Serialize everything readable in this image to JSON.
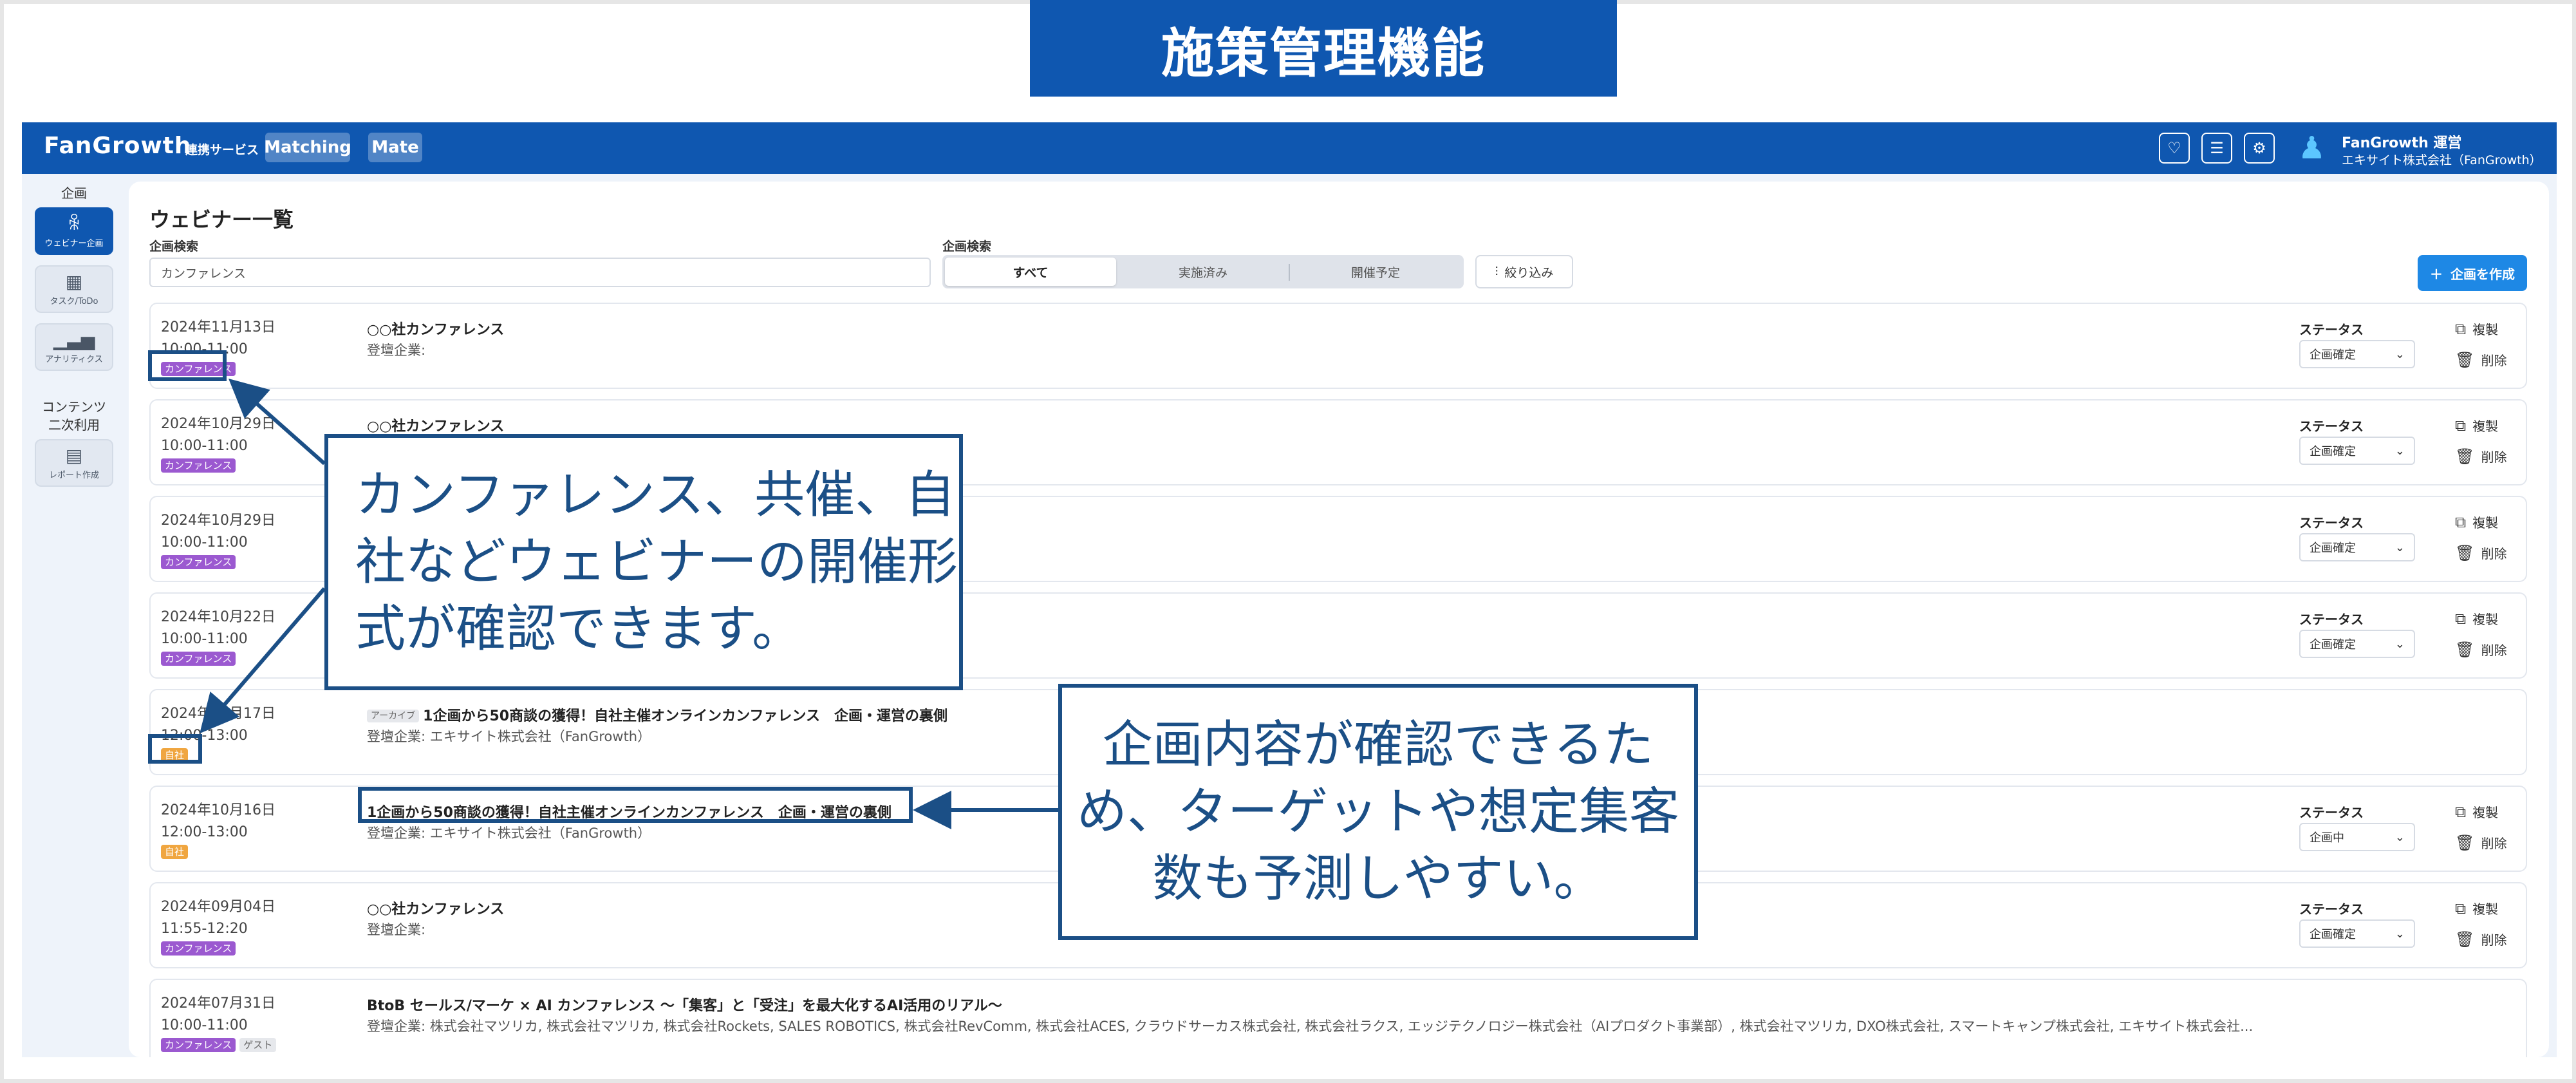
{
  "banner": {
    "title": "施策管理機能"
  },
  "header": {
    "logo": "FanGrowth",
    "services_label": "連携サービス",
    "service_buttons": [
      "Matching",
      "Mate"
    ],
    "user_name": "FanGrowth 運営",
    "user_company": "エキサイト株式会社（FanGrowth）"
  },
  "sidebar": {
    "section1": "企画",
    "items": [
      {
        "label": "ウェビナー企画",
        "icon": "people-icon"
      },
      {
        "label": "タスク/ToDo",
        "icon": "calendar-icon"
      },
      {
        "label": "アナリティクス",
        "icon": "analytics-icon"
      }
    ],
    "section2_line1": "コンテンツ",
    "section2_line2": "二次利用",
    "items2": [
      {
        "label": "レポート作成",
        "icon": "document-icon"
      }
    ]
  },
  "main": {
    "page_title": "ウェビナー一覧",
    "search_label": "企画検索",
    "search_value": "カンファレンス",
    "filter_label": "企画検索",
    "segments": [
      "すべて",
      "実施済み",
      "開催予定"
    ],
    "narrow_button": "絞り込み",
    "create_button": "企画を作成",
    "status_label": "ステータス",
    "copy_label": "複製",
    "delete_label": "削除",
    "company_prefix": "登壇企業:",
    "rows": [
      {
        "date": "2024年11月13日",
        "time": "10:00-11:00",
        "tags": [
          "カンファレンス"
        ],
        "title": "○○社カンファレンス",
        "companies": "",
        "status": "企画確定"
      },
      {
        "date": "2024年10月29日",
        "time": "10:00-11:00",
        "tags": [
          "カンファレンス"
        ],
        "title": "○○社カンファレンス",
        "companies": "",
        "status": "企画確定"
      },
      {
        "date": "2024年10月29日",
        "time": "10:00-11:00",
        "tags": [
          "カンファレンス"
        ],
        "title": "",
        "companies": "",
        "status": "企画確定"
      },
      {
        "date": "2024年10月22日",
        "time": "10:00-11:00",
        "tags": [
          "カンファレンス"
        ],
        "title": "",
        "companies": "",
        "status": "企画確定"
      },
      {
        "date": "2024年10月17日",
        "time": "12:00-13:00",
        "tags": [
          "自社"
        ],
        "archive": "アーカイブ",
        "title": "1企画から50商談の獲得！自社主催オンラインカンファレンス　企画・運営の裏側",
        "companies": "エキサイト株式会社（FanGrowth）",
        "status": ""
      },
      {
        "date": "2024年10月16日",
        "time": "12:00-13:00",
        "tags": [
          "自社"
        ],
        "title": "1企画から50商談の獲得！自社主催オンラインカンファレンス　企画・運営の裏側",
        "companies": "エキサイト株式会社（FanGrowth）",
        "status": "企画中"
      },
      {
        "date": "2024年09月04日",
        "time": "11:55-12:20",
        "tags": [
          "カンファレンス"
        ],
        "title": "○○社カンファレンス",
        "companies": "",
        "status": "企画確定"
      },
      {
        "date": "2024年07月31日",
        "time": "10:00-11:00",
        "tags": [
          "カンファレンス",
          "ゲスト"
        ],
        "title": "BtoB セールス/マーケ × AI カンファレンス 〜「集客」と「受注」を最大化するAI活用のリアル〜",
        "companies": "株式会社マツリカ, 株式会社マツリカ, 株式会社Rockets, SALES ROBOTICS, 株式会社RevComm, 株式会社ACES, クラウドサーカス株式会社, 株式会社ラクス, エッジテクノロジー株式会社（AIプロダクト事業部）, 株式会社マツリカ, DXO株式会社, スマートキャンプ株式会社, エキサイト株式会社...",
        "status": ""
      }
    ]
  },
  "annotations": {
    "callout1": "カンファレンス、共催、自社などウェビナーの開催形式が確認できます。",
    "callout2": "企画内容が確認できるため、ターゲットや想定集客数も予測しやすい。"
  },
  "colors": {
    "brand": "#0f57b0",
    "accent": "#1e88e5",
    "annotation": "#1b4f86",
    "tag_conference": "#9b59d0",
    "tag_self": "#f0a640"
  }
}
